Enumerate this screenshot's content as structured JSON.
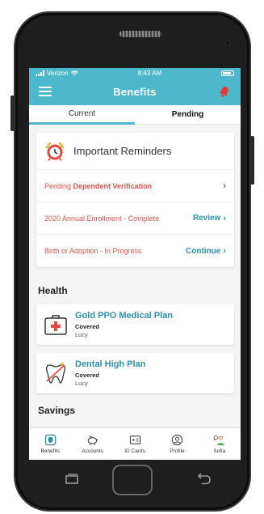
{
  "status_bar": {
    "carrier": "Verizon",
    "time": "8:43 AM"
  },
  "header": {
    "title": "Benefits"
  },
  "tabs": [
    {
      "label": "Current",
      "active": true
    },
    {
      "label": "Pending",
      "active": false
    }
  ],
  "reminders": {
    "title": "Important Reminders",
    "items": [
      {
        "prefix": "Pending",
        "text": "Dependent Verification",
        "action": ""
      },
      {
        "prefix": "",
        "text": "2020 Annual Enrollment - Complete",
        "action": "Review"
      },
      {
        "prefix": "",
        "text": "Birth or Adoption - In Progress",
        "action": "Continue"
      }
    ]
  },
  "health": {
    "title": "Health",
    "plans": [
      {
        "name": "Gold PPO Medical Plan",
        "status": "Covered",
        "member": "Lucy",
        "icon": "medical-kit-icon"
      },
      {
        "name": "Dental High Plan",
        "status": "Covered",
        "member": "Lucy",
        "icon": "tooth-icon"
      }
    ]
  },
  "savings": {
    "title": "Savings"
  },
  "bottom_nav": [
    {
      "label": "Benefits",
      "icon": "shield-icon"
    },
    {
      "label": "Accounts",
      "icon": "piggy-bank-icon"
    },
    {
      "label": "ID Cards",
      "icon": "id-card-icon"
    },
    {
      "label": "Profile",
      "icon": "profile-icon"
    },
    {
      "label": "Sofia",
      "icon": "avatar-icon"
    }
  ],
  "colors": {
    "accent": "#4db8cc",
    "alert_red": "#d9534f",
    "link_blue": "#2b8fb0"
  }
}
